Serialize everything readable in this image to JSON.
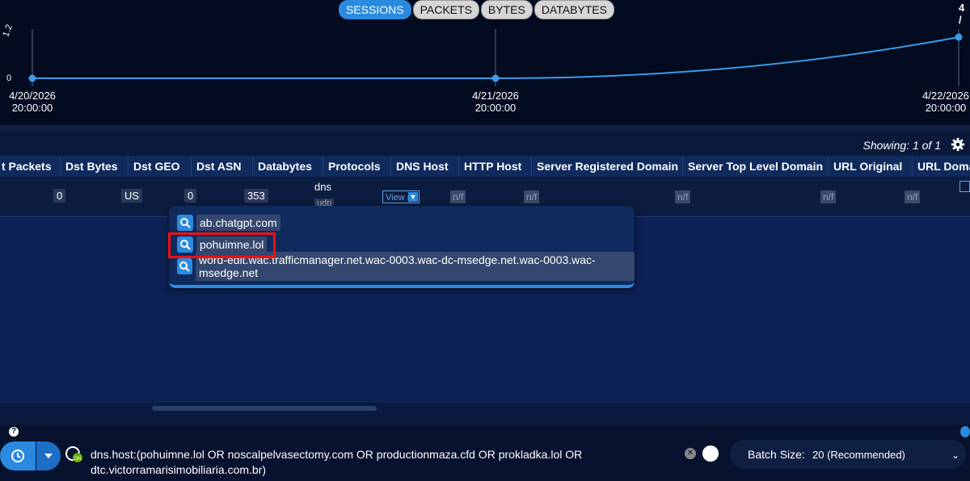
{
  "chart_tabs": [
    "SESSIONS",
    "PACKETS",
    "BYTES",
    "DATABYTES"
  ],
  "chart_top_cut": "4 /",
  "chart_data": {
    "type": "line",
    "x": [
      "4/20/2026 20:00:00",
      "4/21/2026 20:00:00",
      "4/22/2026 20:00:00"
    ],
    "x_labels": [
      [
        "4/20/2026",
        "20:00:00"
      ],
      [
        "4/21/2026",
        "20:00:00"
      ],
      [
        "4/22/2026",
        "20:00:00"
      ]
    ],
    "values": [
      0,
      0,
      1
    ],
    "y_ticks": [
      "0",
      "1.2"
    ],
    "ylim": [
      0,
      1.2
    ],
    "color": "#3b9be8"
  },
  "table": {
    "showing": "Showing: 1 of 1",
    "columns": [
      "t Packets",
      "Dst Bytes",
      "Dst GEO",
      "Dst ASN",
      "Databytes",
      "Protocols",
      "DNS Host",
      "HTTP Host",
      "Server Registered Domain",
      "Server Top Level Domain",
      "URL Original",
      "URL Doma"
    ],
    "row": {
      "dst_packets": "0",
      "dst_geo": "US",
      "dst_asn": "0",
      "databytes": "353",
      "protocol_1": "dns",
      "protocol_2": "udp",
      "dns_view": "View (",
      "nf": "n/f"
    }
  },
  "dns_dropdown": [
    "ab.chatgpt.com",
    "pohuimne.lol",
    "word-edit.wac.trafficmanager.net.wac-0003.wac-dc-msedge.net.wac-0003.wac-msedge.net"
  ],
  "search": {
    "query": "dns.host:(pohuimne.lol OR noscalpelvasectomy.com OR productionmaza.cfd OR prokladka.lol OR dtc.victorramarisimobiliaria.com.br)"
  },
  "batch": {
    "label": "Batch Size:",
    "value": "20 (Recommended)"
  },
  "colors": {
    "accent": "#2a8ae0",
    "highlight": "#e11111"
  }
}
